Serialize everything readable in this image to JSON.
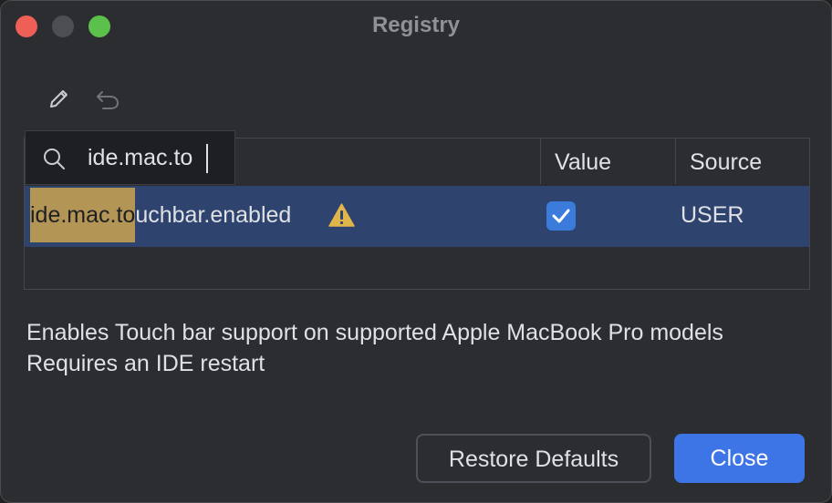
{
  "window": {
    "title": "Registry"
  },
  "toolbar": {
    "edit_icon": "pencil-icon",
    "undo_icon": "undo-icon"
  },
  "search": {
    "value": "ide.mac.to",
    "icon": "search-icon"
  },
  "table": {
    "columns": [
      "",
      "Value",
      "Source"
    ],
    "rows": [
      {
        "key_match": "ide.mac.to",
        "key_rest": "uchbar.enabled",
        "warning_icon": "warning-icon",
        "value_checked": true,
        "source": "USER"
      }
    ]
  },
  "description": {
    "line1": "Enables Touch bar support on supported Apple MacBook Pro models",
    "line2": "Requires an IDE restart"
  },
  "buttons": {
    "restore_defaults": "Restore Defaults",
    "close": "Close"
  },
  "colors": {
    "accent": "#3d74e6",
    "selection_row": "#2e436e",
    "search_highlight": "#b39556",
    "warning": "#e0b54a"
  }
}
